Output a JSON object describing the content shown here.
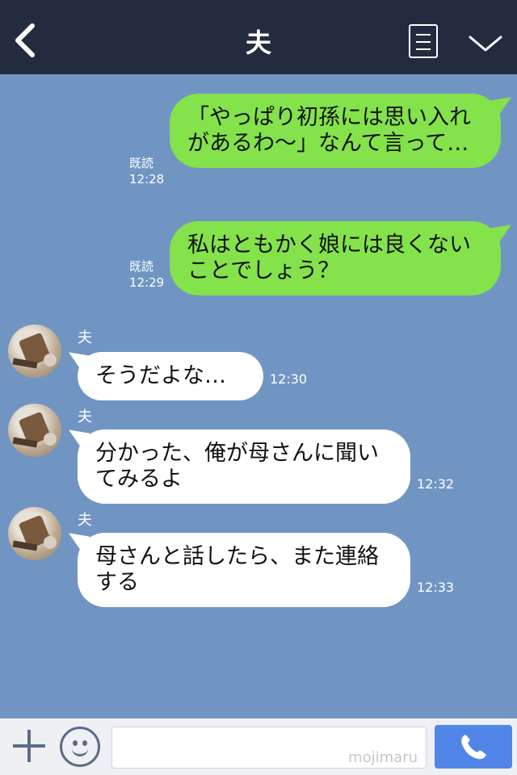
{
  "header": {
    "title": "夫"
  },
  "messages": [
    {
      "direction": "out",
      "text": "「やっぱり初孫には思い入れがあるわ〜」なんて言って…",
      "read": "既読",
      "time": "12:28"
    },
    {
      "direction": "out",
      "text": "私はともかく娘には良くないことでしょう？",
      "read": "既読",
      "time": "12:29"
    },
    {
      "direction": "in",
      "sender": "夫",
      "text": "そうだよな…",
      "time": "12:30"
    },
    {
      "direction": "in",
      "sender": "夫",
      "text": "分かった、俺が母さんに聞いてみるよ",
      "time": "12:32"
    },
    {
      "direction": "in",
      "sender": "夫",
      "text": "母さんと話したら、また連絡する",
      "time": "12:33"
    }
  ],
  "footer": {
    "watermark": "mojimaru"
  },
  "icons": [
    "back-icon",
    "menu-icon",
    "chevron-down-icon",
    "plus-icon",
    "emoji-icon",
    "phone-icon"
  ],
  "colors": {
    "header": "#232c3f",
    "background": "#7195c3",
    "outgoing_bubble": "#84e24b",
    "incoming_bubble": "#ffffff",
    "call_button": "#5186e8"
  }
}
